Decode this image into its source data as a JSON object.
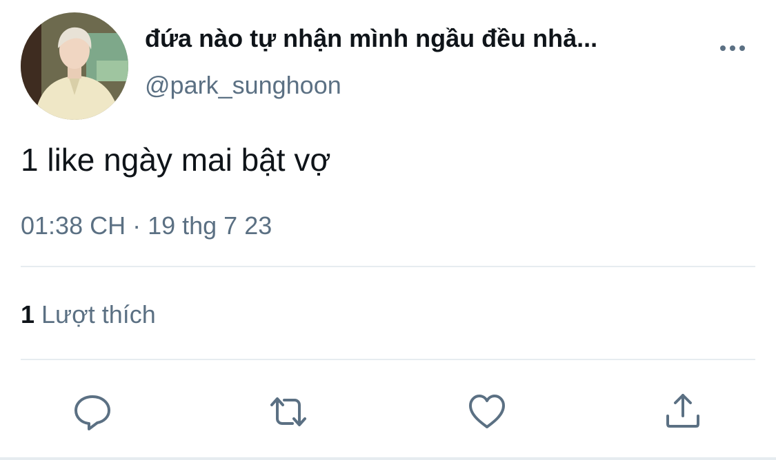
{
  "tweet": {
    "display_name": "đứa nào tự nhận mình ngầu đều nhả...",
    "handle": "@park_sunghoon",
    "text": "1 like ngày mai bật vợ",
    "timestamp": "01:38 CH · 19 thg 7 23",
    "likes_count": "1",
    "likes_label": "Lượt thích"
  },
  "icons": {
    "more": "more-horizontal-icon",
    "reply": "reply-bubble-icon",
    "retweet": "retweet-icon",
    "like": "heart-icon",
    "share": "share-upload-icon"
  },
  "colors": {
    "text_primary": "#0f1419",
    "text_secondary": "#5b7083",
    "divider": "#e6ecf0",
    "icon": "#5b7083"
  }
}
